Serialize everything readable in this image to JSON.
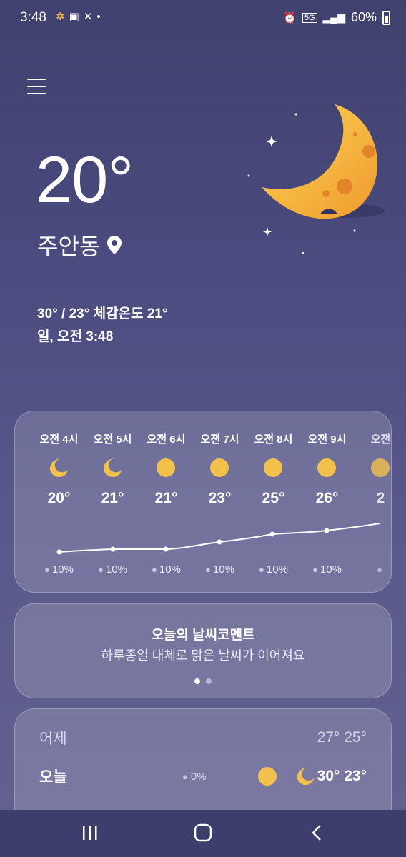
{
  "status": {
    "time": "3:48",
    "battery": "60%",
    "network": "5G"
  },
  "current": {
    "temperature": "20°",
    "location": "주안동",
    "minmax_feels": "30° / 23° 체감온도 21°",
    "datetime": "일, 오전 3:48"
  },
  "hourly": [
    {
      "time": "오전 4시",
      "icon": "moon-crescent-icon",
      "temp": "20°",
      "precip": "10%"
    },
    {
      "time": "오전 5시",
      "icon": "moon-crescent-icon",
      "temp": "21°",
      "precip": "10%"
    },
    {
      "time": "오전 6시",
      "icon": "sun-icon",
      "temp": "21°",
      "precip": "10%"
    },
    {
      "time": "오전 7시",
      "icon": "sun-icon",
      "temp": "23°",
      "precip": "10%"
    },
    {
      "time": "오전 8시",
      "icon": "sun-icon",
      "temp": "25°",
      "precip": "10%"
    },
    {
      "time": "오전 9시",
      "icon": "sun-icon",
      "temp": "26°",
      "precip": "10%"
    },
    {
      "time": "오전",
      "icon": "sun-icon",
      "temp": "2",
      "precip": ""
    }
  ],
  "comment": {
    "title": "오늘의 날씨코멘트",
    "text": "하루종일 대체로 맑은 날씨가 이어져요"
  },
  "daily": {
    "yesterday": {
      "label": "어제",
      "temps": "27° 25°"
    },
    "today": {
      "label": "오늘",
      "precip": "0%",
      "temps": "30° 23°"
    }
  },
  "colors": {
    "sun": "#f2c14b",
    "moon": "#f4b63c"
  }
}
